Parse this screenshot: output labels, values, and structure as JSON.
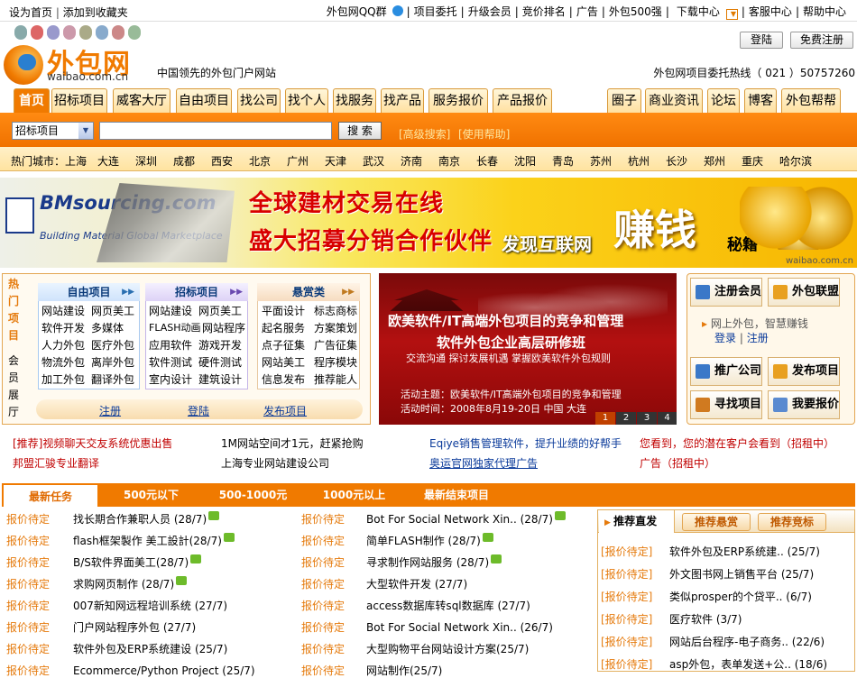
{
  "top": {
    "left_links": [
      "设为首页",
      "添加到收藏夹"
    ],
    "right_links": [
      "外包网QQ群",
      "项目委托",
      "升级会员",
      "竞价排名",
      "广告",
      "外包500强",
      "下载中心",
      "客服中心",
      "帮助中心"
    ]
  },
  "logo": {
    "text": "外包网",
    "domain": "waibao.com.cn"
  },
  "tagline": "中国领先的外包门户网站",
  "buttons": {
    "login": "登陆",
    "register": "免费注册"
  },
  "hotline": "外包网项目委托热线（ 021 ）50757260",
  "nav_left": [
    "首页",
    "招标项目",
    "威客大厅",
    "自由项目",
    "找公司",
    "找个人",
    "找服务",
    "找产品",
    "服务报价",
    "产品报价"
  ],
  "nav_right": [
    "圈子",
    "商业资讯",
    "论坛",
    "博客",
    "外包帮帮"
  ],
  "search": {
    "select_value": "招标项目",
    "button": "搜 索",
    "advanced": "[高级搜索]",
    "help": "[使用帮助]"
  },
  "hot_cities": {
    "label": "热门城市：",
    "cities": [
      "上海",
      "大连",
      "深圳",
      "成都",
      "西安",
      "北京",
      "广州",
      "天津",
      "武汉",
      "济南",
      "南京",
      "长春",
      "沈阳",
      "青岛",
      "苏州",
      "杭州",
      "长沙",
      "郑州",
      "重庆",
      "哈尔滨"
    ]
  },
  "banner": {
    "brand": "BMsourcing.com",
    "brand_sub": "Building Material Global Marketplace",
    "line1": "全球建材交易在线",
    "line2": "盛大招募分销合作伙伴",
    "slogan_a": "发现互联网",
    "slogan_b": "赚钱",
    "slogan_c": "秘籍",
    "watermark": "waibao.com.cn"
  },
  "hot_panel": {
    "vertical_label": [
      "热",
      "门",
      "项",
      "目"
    ],
    "vertical_label2": [
      "会",
      "员",
      "展",
      "厅"
    ],
    "columns": [
      {
        "title": "自由项目",
        "items": [
          "网站建设",
          "网页美工",
          "软件开发",
          "多媒体",
          "人力外包",
          "医疗外包",
          "物流外包",
          "离岸外包",
          "加工外包",
          "翻译外包"
        ]
      },
      {
        "title": "招标项目",
        "items": [
          "网站建设",
          "网页美工",
          "FLASH动画",
          "网站程序",
          "应用软件",
          "游戏开发",
          "软件测试",
          "硬件测试",
          "室内设计",
          "建筑设计"
        ]
      },
      {
        "title": "悬赏类",
        "items": [
          "平面设计",
          "标志商标",
          "起名服务",
          "方案策划",
          "点子征集",
          "广告征集",
          "网站美工",
          "程序模块",
          "信息发布",
          "推荐能人"
        ]
      }
    ],
    "actions": [
      "注册",
      "登陆",
      "发布项目"
    ]
  },
  "slide": {
    "title1": "欧美软件/IT高端外包项目的竞争和管理",
    "title2": "软件外包企业高层研修班",
    "sub": "交流沟通  探讨发展机遇  掌握欧美软件外包规则",
    "info1": "活动主题：欧美软件/IT高端外包项目的竞争和管理",
    "info2": "活动时间：2008年8月19-20日  中国  大连",
    "pages": [
      "1",
      "2",
      "3",
      "4"
    ]
  },
  "member": {
    "register": "注册会员",
    "alliance": "外包联盟",
    "tip": "网上外包，智慧赚钱",
    "login": "登录",
    "reg": "注册",
    "promote": "推广公司",
    "publish": "发布项目",
    "find": "寻找项目",
    "quote": "我要报价"
  },
  "ads": [
    {
      "text": "[推荐]视频聊天交友系统优惠出售",
      "color": "#c00000"
    },
    {
      "text": "1M网站空间才1元，赶紧抢购",
      "color": "#000000"
    },
    {
      "text": "Eqiye销售管理软件，提升业绩的好帮手",
      "color": "#0a3a9a"
    },
    {
      "text": "您看到，您的潜在客户会看到（招租中）",
      "color": "#c00000"
    },
    {
      "text": "邦盟汇骏专业翻译",
      "color": "#c00000"
    },
    {
      "text": "上海专业网站建设公司",
      "color": "#000000"
    },
    {
      "text": "奥运官网独家代理广告",
      "color": "#0a3a9a"
    },
    {
      "text": "广告（招租中）",
      "color": "#c00000"
    }
  ],
  "task_tabs": [
    "最新任务",
    "500元以下",
    "500-1000元",
    "1000元以上",
    "最新结束项目"
  ],
  "tasks_left": [
    {
      "status": "报价待定",
      "title": "找长期合作兼职人员 (28/7)",
      "new": true
    },
    {
      "status": "报价待定",
      "title": "flash框架製作 美工設計(28/7)",
      "new": true
    },
    {
      "status": "报价待定",
      "title": "B/S软件界面美工(28/7)",
      "new": true
    },
    {
      "status": "报价待定",
      "title": "求购网页制作 (28/7)",
      "new": true
    },
    {
      "status": "报价待定",
      "title": "007新知网远程培训系统 (27/7)",
      "new": false
    },
    {
      "status": "报价待定",
      "title": "门户网站程序外包 (27/7)",
      "new": false
    },
    {
      "status": "报价待定",
      "title": "软件外包及ERP系统建设 (25/7)",
      "new": false
    },
    {
      "status": "报价待定",
      "title": "Ecommerce/Python Project (25/7)",
      "new": false
    }
  ],
  "tasks_mid": [
    {
      "status": "报价待定",
      "title": "Bot For Social Network Xin.. (28/7)",
      "new": true
    },
    {
      "status": "报价待定",
      "title": "简单FLASH制作 (28/7)",
      "new": true
    },
    {
      "status": "报价待定",
      "title": "寻求制作网站服务 (28/7)",
      "new": true
    },
    {
      "status": "报价待定",
      "title": "大型软件开发 (27/7)",
      "new": false
    },
    {
      "status": "报价待定",
      "title": "access数据库转sql数据库 (27/7)",
      "new": false
    },
    {
      "status": "报价待定",
      "title": "Bot For Social Network Xin.. (26/7)",
      "new": false
    },
    {
      "status": "报价待定",
      "title": "大型购物平台网站设计方案(25/7)",
      "new": false
    },
    {
      "status": "报价待定",
      "title": "网站制作(25/7)",
      "new": false
    }
  ],
  "right_tabs": [
    "推荐直发",
    "推荐悬赏",
    "推荐竞标"
  ],
  "tasks_right": [
    {
      "status": "[报价待定]",
      "title": "软件外包及ERP系统建.. (25/7)"
    },
    {
      "status": "[报价待定]",
      "title": "外文图书网上销售平台 (25/7)"
    },
    {
      "status": "[报价待定]",
      "title": "类似prosper的个贷平.. (6/7)"
    },
    {
      "status": "[报价待定]",
      "title": "医疗软件 (3/7)"
    },
    {
      "status": "[报价待定]",
      "title": "网站后台程序-电子商务.. (22/6)"
    },
    {
      "status": "[报价待定]",
      "title": "asp外包，表单发送+公.. (18/6)"
    }
  ],
  "colors": {
    "orange": "#f07a00",
    "dark_orange": "#e06a00",
    "link_blue": "#0a3a9a",
    "status_orange": "#e57a0c"
  }
}
